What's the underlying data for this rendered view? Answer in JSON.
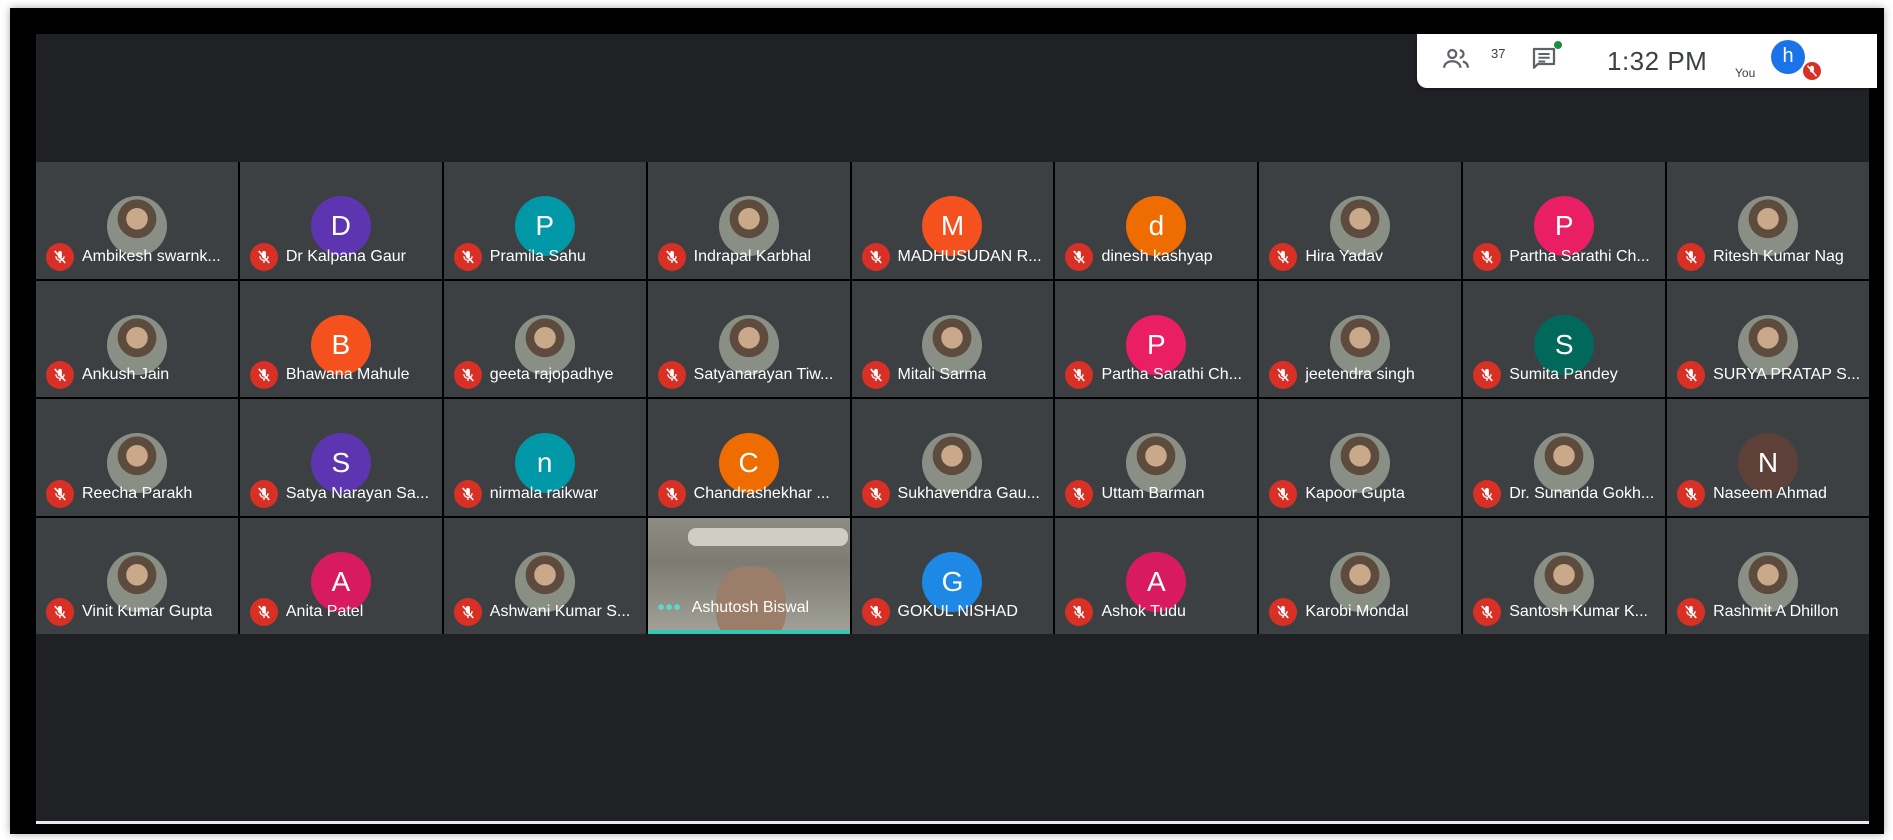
{
  "status": {
    "people_count": "37",
    "time": "1:32 PM",
    "you_label": "You",
    "you_initial": "h"
  },
  "colors": {
    "background": "#202124",
    "tile": "#3c4043",
    "muted_badge": "#d93025",
    "speaking_bar": "#33c7b3"
  },
  "participants": [
    {
      "name": "Ambikesh swarnk...",
      "avatar": "photo",
      "color": ""
    },
    {
      "name": "Dr Kalpana Gaur",
      "avatar": "D",
      "color": "#5e35b1"
    },
    {
      "name": "Pramila Sahu",
      "avatar": "P",
      "color": "#0097a7"
    },
    {
      "name": "Indrapal Karbhal",
      "avatar": "photo",
      "color": ""
    },
    {
      "name": "MADHUSUDAN R...",
      "avatar": "M",
      "color": "#f4511e"
    },
    {
      "name": "dinesh kashyap",
      "avatar": "d",
      "color": "#ef6c00"
    },
    {
      "name": "Hira Yadav",
      "avatar": "photo",
      "color": ""
    },
    {
      "name": "Partha Sarathi Ch...",
      "avatar": "P",
      "color": "#e91e63"
    },
    {
      "name": "Ritesh Kumar Nag",
      "avatar": "photo",
      "color": ""
    },
    {
      "name": "Ankush Jain",
      "avatar": "photo",
      "color": ""
    },
    {
      "name": "Bhawana Mahule",
      "avatar": "B",
      "color": "#f4511e"
    },
    {
      "name": "geeta rajopadhye",
      "avatar": "photo",
      "color": ""
    },
    {
      "name": "Satyanarayan Tiw...",
      "avatar": "photo",
      "color": ""
    },
    {
      "name": "Mitali Sarma",
      "avatar": "photo",
      "color": ""
    },
    {
      "name": "Partha Sarathi Ch...",
      "avatar": "P",
      "color": "#e91e63"
    },
    {
      "name": "jeetendra singh",
      "avatar": "photo",
      "color": ""
    },
    {
      "name": "Sumita Pandey",
      "avatar": "S",
      "color": "#00695c"
    },
    {
      "name": "SURYA PRATAP S...",
      "avatar": "photo",
      "color": ""
    },
    {
      "name": "Reecha Parakh",
      "avatar": "photo",
      "color": ""
    },
    {
      "name": "Satya Narayan Sa...",
      "avatar": "S",
      "color": "#5e35b1"
    },
    {
      "name": "nirmala raikwar",
      "avatar": "n",
      "color": "#0097a7"
    },
    {
      "name": "Chandrashekhar ...",
      "avatar": "C",
      "color": "#ef6c00"
    },
    {
      "name": "Sukhavendra Gau...",
      "avatar": "photo",
      "color": ""
    },
    {
      "name": "Uttam Barman",
      "avatar": "photo",
      "color": ""
    },
    {
      "name": "Kapoor Gupta",
      "avatar": "photo",
      "color": ""
    },
    {
      "name": "Dr. Sunanda Gokh...",
      "avatar": "photo",
      "color": ""
    },
    {
      "name": "Naseem Ahmad",
      "avatar": "N",
      "color": "#5d4037"
    },
    {
      "name": "Vinit Kumar Gupta",
      "avatar": "photo",
      "color": ""
    },
    {
      "name": "Anita Patel",
      "avatar": "A",
      "color": "#d81b60"
    },
    {
      "name": "Ashwani Kumar S...",
      "avatar": "photo",
      "color": ""
    },
    {
      "name": "Ashutosh Biswal",
      "avatar": "video",
      "color": ""
    },
    {
      "name": "GOKUL NISHAD",
      "avatar": "G",
      "color": "#1e88e5"
    },
    {
      "name": "Ashok Tudu",
      "avatar": "A",
      "color": "#d81b60"
    },
    {
      "name": "Karobi Mondal",
      "avatar": "photo",
      "color": ""
    },
    {
      "name": "Santosh Kumar K...",
      "avatar": "photo",
      "color": ""
    },
    {
      "name": "Rashmit A Dhillon",
      "avatar": "photo",
      "color": ""
    }
  ]
}
